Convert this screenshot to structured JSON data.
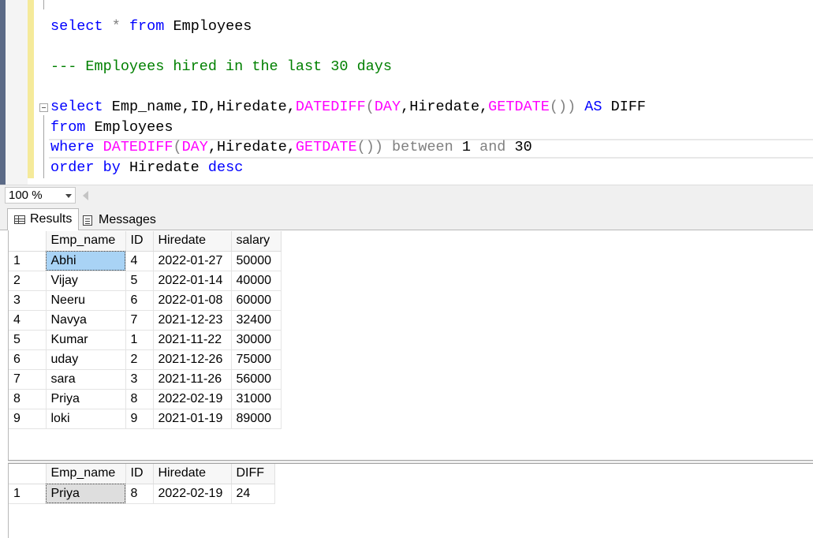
{
  "editor": {
    "line1": {
      "kw1": "select",
      "op1": "*",
      "kw2": "from",
      "rest": "Employees"
    },
    "comment": "--- Employees hired in the last 30 days",
    "line3": {
      "kw": "select",
      "cols": "Emp_name,ID,Hiredate,",
      "fn1": "DATEDIFF",
      "p1": "(",
      "fn2": "DAY",
      "mid": ",Hiredate,",
      "fn3": "GETDATE",
      "p2": "())",
      "kw2": "AS",
      "alias": "DIFF"
    },
    "line4": {
      "kw": "from",
      "rest": "Employees"
    },
    "line5": {
      "kw": "where",
      "fn1": "DATEDIFF",
      "p1": "(",
      "fn2": "DAY",
      "mid": ",Hiredate,",
      "fn3": "GETDATE",
      "p2": "())",
      "op": "between",
      "n1": "1",
      "op2": "and",
      "n2": "30"
    },
    "line6": {
      "kw1": "order",
      "kw2": "by",
      "col": "Hiredate",
      "kw3": "desc"
    }
  },
  "zoom": {
    "value": "100 %"
  },
  "tabs": {
    "results": "Results",
    "messages": "Messages"
  },
  "grid1": {
    "headers": [
      "Emp_name",
      "ID",
      "Hiredate",
      "salary"
    ],
    "rows": [
      [
        "1",
        "Abhi",
        "4",
        "2022-01-27",
        "50000"
      ],
      [
        "2",
        "Vijay",
        "5",
        "2022-01-14",
        "40000"
      ],
      [
        "3",
        "Neeru",
        "6",
        "2022-01-08",
        "60000"
      ],
      [
        "4",
        "Navya",
        "7",
        "2021-12-23",
        "32400"
      ],
      [
        "5",
        "Kumar",
        "1",
        "2021-11-22",
        "30000"
      ],
      [
        "6",
        "uday",
        "2",
        "2021-12-26",
        "75000"
      ],
      [
        "7",
        "sara",
        "3",
        "2021-11-26",
        "56000"
      ],
      [
        "8",
        "Priya",
        "8",
        "2022-02-19",
        "31000"
      ],
      [
        "9",
        "loki",
        "9",
        "2021-01-19",
        "89000"
      ]
    ]
  },
  "grid2": {
    "headers": [
      "Emp_name",
      "ID",
      "Hiredate",
      "DIFF"
    ],
    "rows": [
      [
        "1",
        "Priya",
        "8",
        "2022-02-19",
        "24"
      ]
    ]
  }
}
